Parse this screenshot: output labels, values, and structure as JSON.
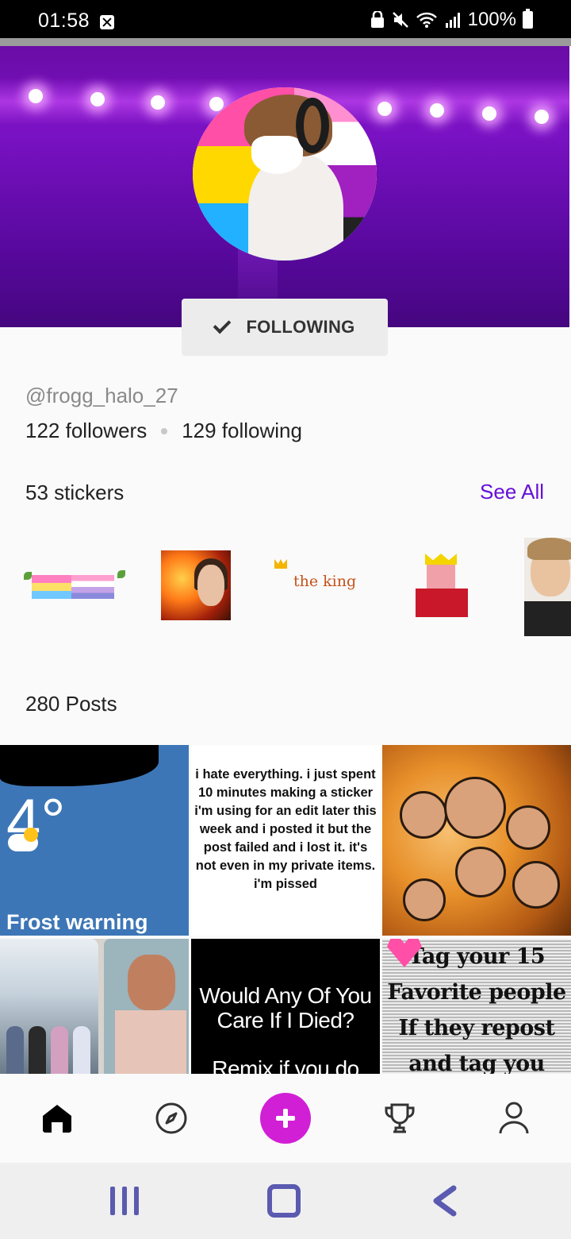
{
  "status_bar": {
    "time": "01:58",
    "battery": "100%"
  },
  "profile": {
    "follow_button_label": "FOLLOWING",
    "handle": "@frogg_halo_27",
    "followers": "122 followers",
    "following": "129 following"
  },
  "stickers": {
    "label": "53 stickers",
    "see_all": "See All",
    "king_text": "the king"
  },
  "posts": {
    "label": "280 Posts",
    "items": [
      {
        "temp": "4°",
        "caption": "Frost warning"
      },
      {
        "text": "i hate everything. i just spent 10 minutes making a sticker i'm using for an edit later this week and i posted it but the post failed and i lost it. it's not even in my private items. i'm pissed"
      },
      {
        "image": "collage"
      },
      {
        "image": "photo"
      },
      {
        "line1": "Would Any Of You",
        "line2": "Care If I Died?",
        "line3": "Remix if you do"
      },
      {
        "line1": "Tag your 15",
        "line2": "Favorite people",
        "line3": "If they repost",
        "line4": "and tag you back,"
      }
    ]
  },
  "bottom_nav": [
    "home-icon",
    "explore-icon",
    "create-icon",
    "trophy-icon",
    "profile-icon"
  ],
  "colors": {
    "accent": "#6610d8",
    "create": "#d11fd6",
    "banner": "#6a0ca6"
  }
}
